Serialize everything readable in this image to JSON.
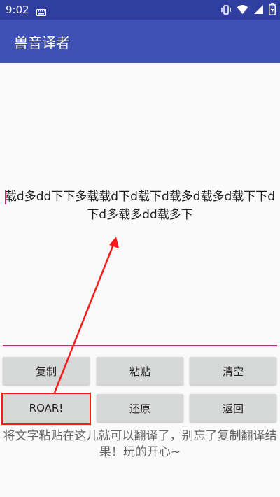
{
  "status_bar": {
    "time": "9:02",
    "left_icons": [
      "keyboard-icon"
    ],
    "right_icons": [
      "vibrate-icon",
      "wifi-icon",
      "signal-icon",
      "battery-icon"
    ]
  },
  "app_bar": {
    "title": "兽音译者"
  },
  "editor": {
    "value": "载d多dd下下多载载d下d载下d载多d载多d载下下d下d多载多dd载多下"
  },
  "buttons": {
    "copy": "复制",
    "paste": "粘贴",
    "clear": "清空",
    "roar": "ROAR!",
    "restore": "还原",
    "back": "返回"
  },
  "hint": "将文字粘贴在这儿就可以翻译了，别忘了复制翻译结果！玩的开心~",
  "colors": {
    "status_bar": "#303f9f",
    "app_bar": "#3f51b5",
    "accent": "#e91e63",
    "button_bg": "#d6d7d7",
    "annotation": "#ff1a1a"
  }
}
